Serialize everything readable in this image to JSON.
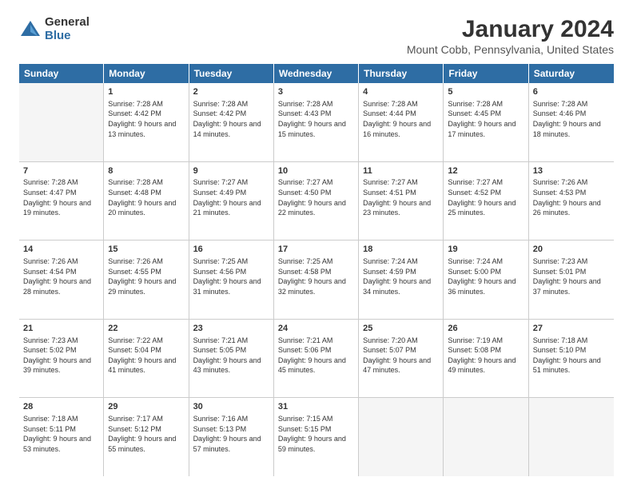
{
  "logo": {
    "general": "General",
    "blue": "Blue"
  },
  "title": "January 2024",
  "subtitle": "Mount Cobb, Pennsylvania, United States",
  "days_of_week": [
    "Sunday",
    "Monday",
    "Tuesday",
    "Wednesday",
    "Thursday",
    "Friday",
    "Saturday"
  ],
  "weeks": [
    [
      {
        "day": "",
        "empty": true
      },
      {
        "day": "1",
        "sunrise": "7:28 AM",
        "sunset": "4:42 PM",
        "daylight": "9 hours and 13 minutes."
      },
      {
        "day": "2",
        "sunrise": "7:28 AM",
        "sunset": "4:42 PM",
        "daylight": "9 hours and 14 minutes."
      },
      {
        "day": "3",
        "sunrise": "7:28 AM",
        "sunset": "4:43 PM",
        "daylight": "9 hours and 15 minutes."
      },
      {
        "day": "4",
        "sunrise": "7:28 AM",
        "sunset": "4:44 PM",
        "daylight": "9 hours and 16 minutes."
      },
      {
        "day": "5",
        "sunrise": "7:28 AM",
        "sunset": "4:45 PM",
        "daylight": "9 hours and 17 minutes."
      },
      {
        "day": "6",
        "sunrise": "7:28 AM",
        "sunset": "4:46 PM",
        "daylight": "9 hours and 18 minutes."
      }
    ],
    [
      {
        "day": "7",
        "sunrise": "7:28 AM",
        "sunset": "4:47 PM",
        "daylight": "9 hours and 19 minutes."
      },
      {
        "day": "8",
        "sunrise": "7:28 AM",
        "sunset": "4:48 PM",
        "daylight": "9 hours and 20 minutes."
      },
      {
        "day": "9",
        "sunrise": "7:27 AM",
        "sunset": "4:49 PM",
        "daylight": "9 hours and 21 minutes."
      },
      {
        "day": "10",
        "sunrise": "7:27 AM",
        "sunset": "4:50 PM",
        "daylight": "9 hours and 22 minutes."
      },
      {
        "day": "11",
        "sunrise": "7:27 AM",
        "sunset": "4:51 PM",
        "daylight": "9 hours and 23 minutes."
      },
      {
        "day": "12",
        "sunrise": "7:27 AM",
        "sunset": "4:52 PM",
        "daylight": "9 hours and 25 minutes."
      },
      {
        "day": "13",
        "sunrise": "7:26 AM",
        "sunset": "4:53 PM",
        "daylight": "9 hours and 26 minutes."
      }
    ],
    [
      {
        "day": "14",
        "sunrise": "7:26 AM",
        "sunset": "4:54 PM",
        "daylight": "9 hours and 28 minutes."
      },
      {
        "day": "15",
        "sunrise": "7:26 AM",
        "sunset": "4:55 PM",
        "daylight": "9 hours and 29 minutes."
      },
      {
        "day": "16",
        "sunrise": "7:25 AM",
        "sunset": "4:56 PM",
        "daylight": "9 hours and 31 minutes."
      },
      {
        "day": "17",
        "sunrise": "7:25 AM",
        "sunset": "4:58 PM",
        "daylight": "9 hours and 32 minutes."
      },
      {
        "day": "18",
        "sunrise": "7:24 AM",
        "sunset": "4:59 PM",
        "daylight": "9 hours and 34 minutes."
      },
      {
        "day": "19",
        "sunrise": "7:24 AM",
        "sunset": "5:00 PM",
        "daylight": "9 hours and 36 minutes."
      },
      {
        "day": "20",
        "sunrise": "7:23 AM",
        "sunset": "5:01 PM",
        "daylight": "9 hours and 37 minutes."
      }
    ],
    [
      {
        "day": "21",
        "sunrise": "7:23 AM",
        "sunset": "5:02 PM",
        "daylight": "9 hours and 39 minutes."
      },
      {
        "day": "22",
        "sunrise": "7:22 AM",
        "sunset": "5:04 PM",
        "daylight": "9 hours and 41 minutes."
      },
      {
        "day": "23",
        "sunrise": "7:21 AM",
        "sunset": "5:05 PM",
        "daylight": "9 hours and 43 minutes."
      },
      {
        "day": "24",
        "sunrise": "7:21 AM",
        "sunset": "5:06 PM",
        "daylight": "9 hours and 45 minutes."
      },
      {
        "day": "25",
        "sunrise": "7:20 AM",
        "sunset": "5:07 PM",
        "daylight": "9 hours and 47 minutes."
      },
      {
        "day": "26",
        "sunrise": "7:19 AM",
        "sunset": "5:08 PM",
        "daylight": "9 hours and 49 minutes."
      },
      {
        "day": "27",
        "sunrise": "7:18 AM",
        "sunset": "5:10 PM",
        "daylight": "9 hours and 51 minutes."
      }
    ],
    [
      {
        "day": "28",
        "sunrise": "7:18 AM",
        "sunset": "5:11 PM",
        "daylight": "9 hours and 53 minutes."
      },
      {
        "day": "29",
        "sunrise": "7:17 AM",
        "sunset": "5:12 PM",
        "daylight": "9 hours and 55 minutes."
      },
      {
        "day": "30",
        "sunrise": "7:16 AM",
        "sunset": "5:13 PM",
        "daylight": "9 hours and 57 minutes."
      },
      {
        "day": "31",
        "sunrise": "7:15 AM",
        "sunset": "5:15 PM",
        "daylight": "9 hours and 59 minutes."
      },
      {
        "day": "",
        "empty": true
      },
      {
        "day": "",
        "empty": true
      },
      {
        "day": "",
        "empty": true
      }
    ]
  ],
  "labels": {
    "sunrise": "Sunrise:",
    "sunset": "Sunset:",
    "daylight": "Daylight:"
  }
}
